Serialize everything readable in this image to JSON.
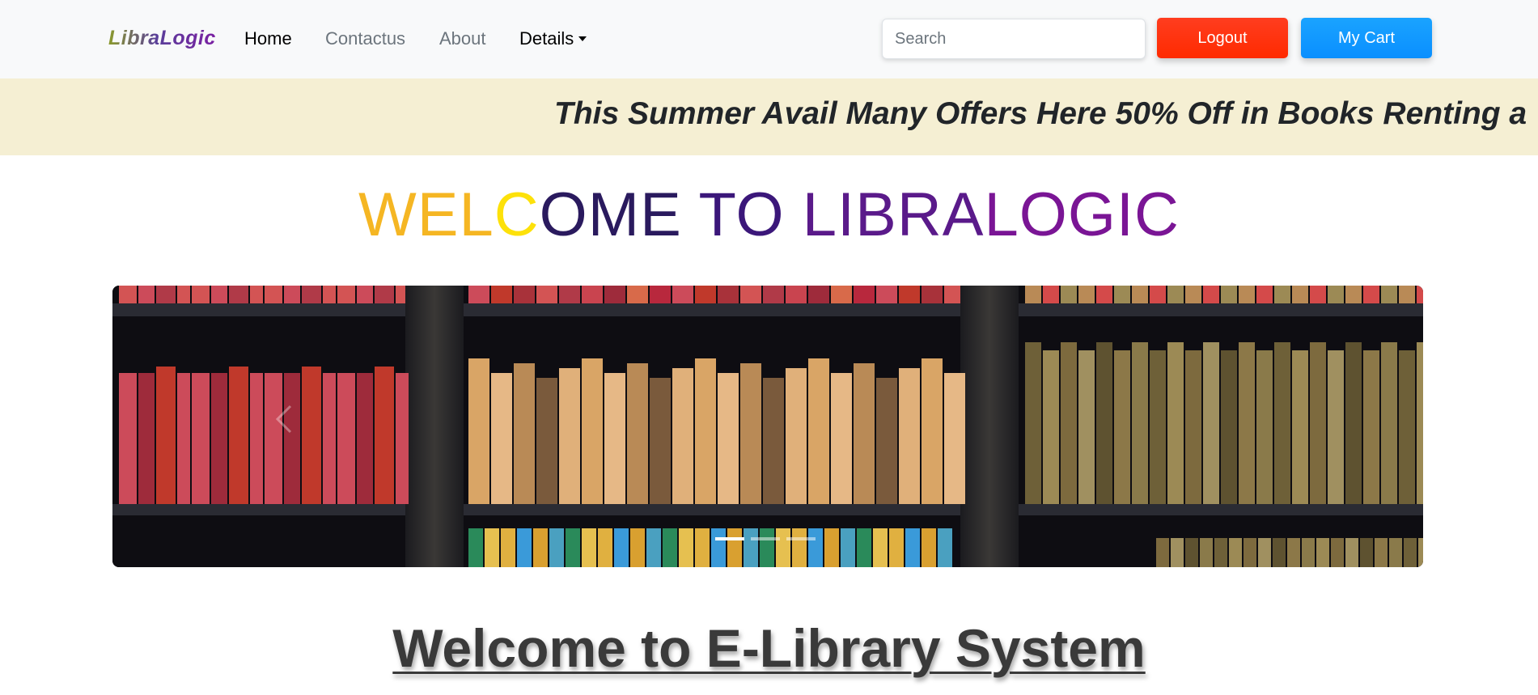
{
  "navbar": {
    "brand": "LibraLogic",
    "links": [
      {
        "label": "Home",
        "active": true
      },
      {
        "label": "Contactus"
      },
      {
        "label": "About"
      },
      {
        "label": "Details"
      }
    ],
    "search_placeholder": "Search",
    "logout_label": "Logout",
    "cart_label": "My Cart",
    "colors": {
      "logout": "#ff2a00",
      "cart": "#0a8fff",
      "navbar_bg": "#f8f9fa"
    }
  },
  "banner": {
    "text": "This Summer Avail Many Offers Here 50% Off in Books Renting a",
    "bg_color": "#f5efd3"
  },
  "welcome": {
    "parts": [
      "WEL",
      "C",
      "OME ",
      "TO ",
      "LIBRA",
      "LOGIC"
    ]
  },
  "carousel": {
    "slide_description_icon": "bookshelf-image",
    "slide_count": 3,
    "active_slide": 1,
    "prev_icon": "chevron-left-icon",
    "next_icon": "chevron-right-icon"
  },
  "main": {
    "heading": "Welcome to E-Library System"
  }
}
